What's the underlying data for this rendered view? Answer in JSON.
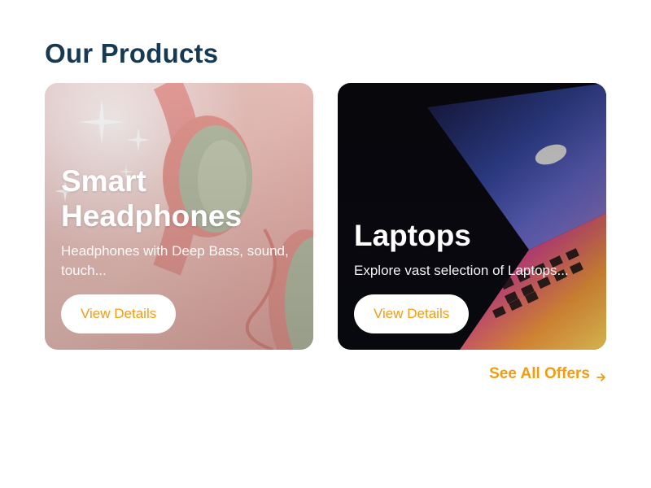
{
  "section": {
    "title": "Our Products"
  },
  "cards": [
    {
      "title_line1": "Smart",
      "title_line2": "Headphones",
      "description": "Headphones with Deep Bass, sound, touch...",
      "button_label": "View Details",
      "image": "pink-headphones-photo"
    },
    {
      "title": "Laptops",
      "description": "Explore vast selection of Laptops...",
      "button_label": "View Details",
      "image": "laptop-rainbow-light-photo"
    }
  ],
  "footer": {
    "see_all_label": "See All Offers",
    "icon": "arrow-right-icon"
  },
  "colors": {
    "title": "#173a52",
    "accent": "#f39c12",
    "button_bg": "#ffffff"
  }
}
